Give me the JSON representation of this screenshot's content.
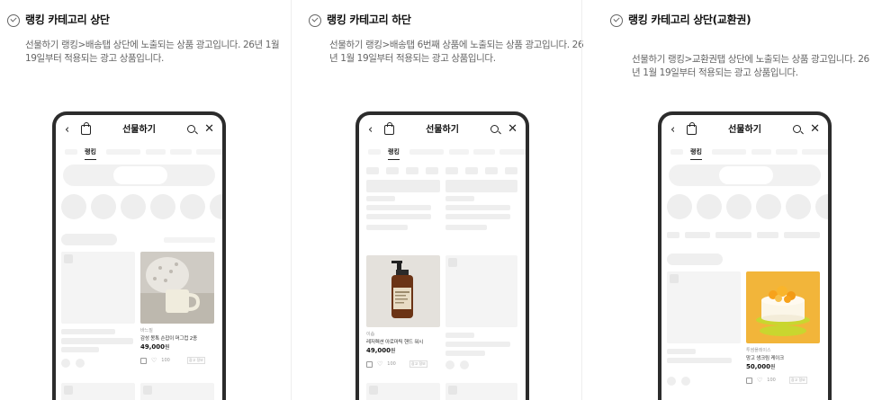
{
  "cards": [
    {
      "title": "랭킹 카테고리 상단",
      "description": "선물하기 랭킹>배송탭 상단에 노출되는 상품 광고입니다. 26년 1월 19일부터 적용되는 광고 상품입니다.",
      "phone": {
        "nav_title": "선물하기",
        "tab": "랭킹",
        "product": {
          "brand": "바느질",
          "name": "감성 몽톡 손잡이 머그컵 2종",
          "price": "49,000",
          "price_unit": "원",
          "likes": "100",
          "ad_badge": "광고 정보"
        }
      }
    },
    {
      "title": "랭킹 카테고리 하단",
      "description": "선물하기 랭킹>배송탭 6번째 상품에 노출되는 상품 광고입니다. 26년 1월 19일부터 적용되는 광고 상품입니다.",
      "phone": {
        "nav_title": "선물하기",
        "tab": "랭킹",
        "product": {
          "brand": "이솝",
          "name": "레저렉션 아로마틱 핸드 워시",
          "price": "49,000",
          "price_unit": "원",
          "likes": "100",
          "ad_badge": "광고 정보"
        }
      }
    },
    {
      "title": "랭킹 카테고리 상단(교환권)",
      "description": "선물하기 랭킹>교환권탭 상단에 노출되는 상품 광고입니다. 26년 1월 19일부터 적용되는 광고 상품입니다.",
      "phone": {
        "nav_title": "선물하기",
        "tab": "랭킹",
        "product": {
          "brand": "투썸플레이스",
          "name": "망고 생크림 케이크",
          "price": "50,000",
          "price_unit": "원",
          "likes": "100",
          "ad_badge": "광고 정보"
        }
      }
    }
  ]
}
